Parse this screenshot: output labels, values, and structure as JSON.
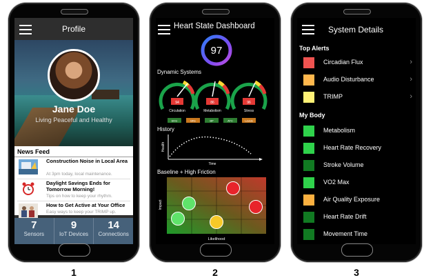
{
  "phone1": {
    "title": "Profile",
    "name": "Jane Doe",
    "tagline": "Living Peaceful and Healthy",
    "news_heading": "News Feed",
    "news": [
      {
        "title": "Construction Noise in Local Area",
        "snippet": "At 3pm today, local maintenance."
      },
      {
        "title": "Daylight Savings Ends for Tomorrow Morning!",
        "snippet": "Tips on how to keep your rhythm."
      },
      {
        "title": "How to Get Active at Your Office",
        "snippet": "Easy ways to keep your TRIMP up."
      }
    ],
    "stats": [
      {
        "value": "7",
        "label": "Sensors"
      },
      {
        "value": "9",
        "label": "IoT Devices"
      },
      {
        "value": "14",
        "label": "Connections"
      }
    ],
    "caption": "1"
  },
  "phone2": {
    "title": "Heart State Dashboard",
    "score": "97",
    "dynamic_heading": "Dynamic Systems",
    "gauges": [
      {
        "label": "Circulation",
        "value": "94"
      },
      {
        "label": "Metabolism",
        "value": "86"
      },
      {
        "label": "Stress",
        "value": "96"
      }
    ],
    "chips": [
      {
        "text": "EKG",
        "color": "#2e7d32"
      },
      {
        "text": "BRs",
        "color": "#c8781e"
      },
      {
        "text": "BP",
        "color": "#2e7d32"
      },
      {
        "text": "ATC",
        "color": "#2e7d32"
      },
      {
        "text": "Levels",
        "color": "#c8781e"
      }
    ],
    "history_heading": "History",
    "history_ylabel": "Health",
    "history_xlabel": "Time",
    "matrix_heading": "Baseline + High Friction",
    "matrix_ylabel": "Impact",
    "matrix_xlabel": "Likelihood",
    "caption": "2"
  },
  "phone3": {
    "title": "System Details",
    "alerts_heading": "Top Alerts",
    "alerts": [
      {
        "label": "Circadian Flux",
        "color": "#ef5350"
      },
      {
        "label": "Audio Disturbance",
        "color": "#ffb74d"
      },
      {
        "label": "TRIMP",
        "color": "#fff176"
      }
    ],
    "body_heading": "My Body",
    "body": [
      {
        "label": "Metabolism",
        "color": "#2fd24b"
      },
      {
        "label": "Heart Rate Recovery",
        "color": "#2fd24b"
      },
      {
        "label": "Stroke Volume",
        "color": "#117a22"
      },
      {
        "label": "VO2 Max",
        "color": "#2fd24b"
      },
      {
        "label": "Air Quality Exposure",
        "color": "#fbb040"
      },
      {
        "label": "Heart Rate Drift",
        "color": "#117a22"
      },
      {
        "label": "Movement Time",
        "color": "#117a22"
      }
    ],
    "caption": "3"
  },
  "icons": {
    "menu": "hamburger-menu-icon",
    "chevron": "chevron-right-icon"
  }
}
